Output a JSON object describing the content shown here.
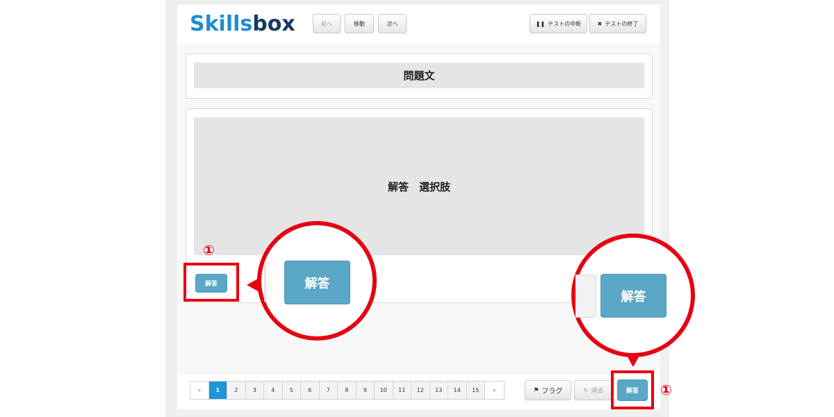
{
  "logo": {
    "part1": "Skills",
    "part2": "box"
  },
  "header": {
    "prev_label": "前へ",
    "move_label": "移動",
    "next_label": "次へ",
    "suspend_label": "テストの中断",
    "end_label": "テストの終了"
  },
  "question": {
    "text": "問題文"
  },
  "answer": {
    "text": "解答　選択肢"
  },
  "answer_button": {
    "label": "解答"
  },
  "callout": {
    "marker": "①"
  },
  "pagination": {
    "prev": "«",
    "next": "»",
    "pages": [
      "1",
      "2",
      "3",
      "4",
      "5",
      "6",
      "7",
      "8",
      "9",
      "10",
      "11",
      "12",
      "13",
      "14",
      "15"
    ],
    "current": "1"
  },
  "footer": {
    "flag_label": "フラグ",
    "clear_label": "消去",
    "submit_label": "解答"
  },
  "colors": {
    "accent": "#5aa7c6",
    "highlight": "#e60012",
    "page_active": "#1d97d8"
  }
}
